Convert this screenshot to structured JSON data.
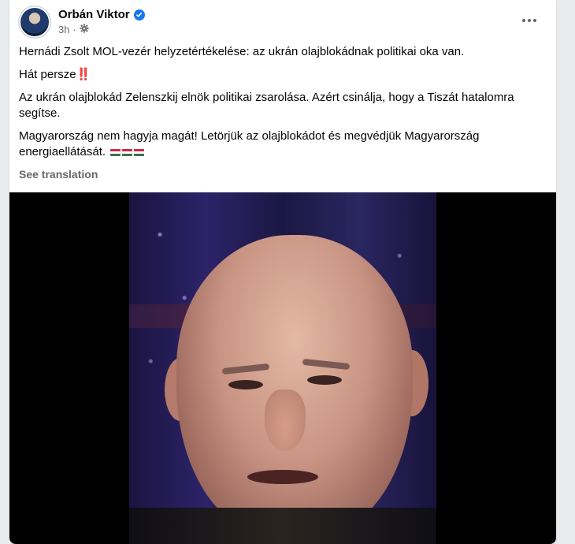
{
  "post": {
    "author": "Orbán Viktor",
    "time": "3h",
    "paragraphs": [
      "Hernádi Zsolt MOL-vezér helyzetértékelése: az ukrán olajblokádnak politikai oka van.",
      "Hát persze",
      "Az ukrán olajblokád Zelenszkij elnök politikai zsarolása. Azért csinálja, hogy a Tiszát hatalomra segítse.",
      "Magyarország nem hagyja magát! Letörjük az olajblokádot és megvédjük Magyarország energiaellátását."
    ],
    "emphasis_emoji": "‼️",
    "see_translation": "See translation"
  },
  "icons": {
    "verified": "verified-badge-icon",
    "audience": "gear-icon",
    "more": "more-options-icon"
  },
  "colors": {
    "accent": "#1877f2",
    "secondary_text": "#65676b"
  }
}
